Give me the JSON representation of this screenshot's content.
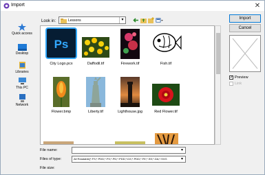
{
  "window": {
    "title": "Import"
  },
  "places": [
    {
      "label": "Quick access"
    },
    {
      "label": "Desktop"
    },
    {
      "label": "Libraries"
    },
    {
      "label": "This PC"
    },
    {
      "label": "Network"
    }
  ],
  "lookin": {
    "label": "Look in:",
    "value": "Lessons"
  },
  "files": [
    {
      "name": "City Logo.pcx"
    },
    {
      "name": "Daffodil.tif"
    },
    {
      "name": "Firework.tif"
    },
    {
      "name": "Fish.tif"
    },
    {
      "name": "Flower.bmp"
    },
    {
      "name": "Liberty.tif"
    },
    {
      "name": "Lighthouse.jpg"
    },
    {
      "name": "Red Flower.tif"
    }
  ],
  "bottom": {
    "filename_label": "File name:",
    "filename_value": "",
    "filetype_label": "Files of type:",
    "filetype_value": "All Readable(*.FS;*.PDD;*.FS;*.PD;*.PDD;*.DX;*.PDD;*.FE;*.SS;*.DA;*.SVG",
    "filesize_label": "File size:"
  },
  "buttons": {
    "import": "Import",
    "cancel": "Cancel"
  },
  "options": {
    "preview": "Preview",
    "link": "Link"
  }
}
